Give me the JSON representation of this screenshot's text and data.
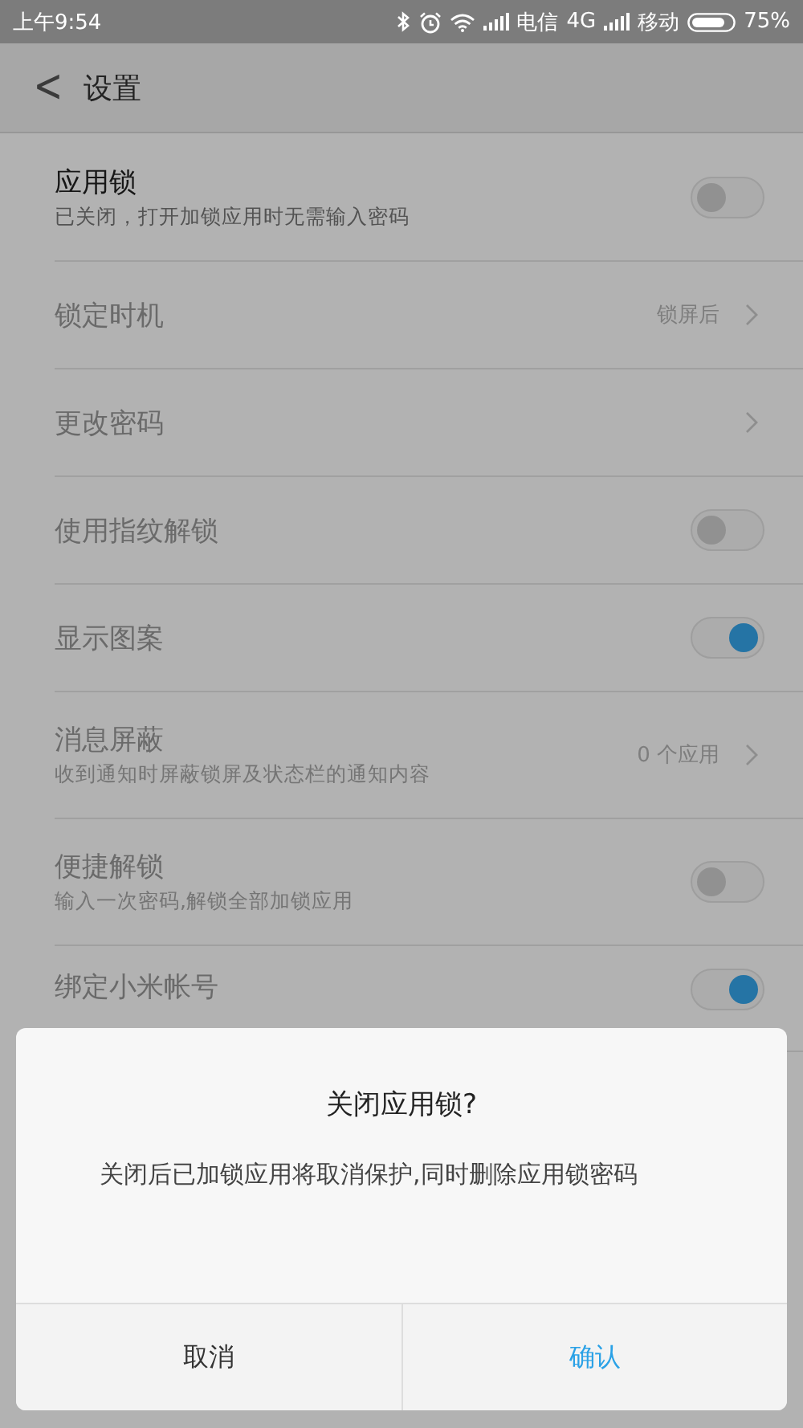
{
  "status_bar": {
    "time": "上午9:54",
    "carrier_1": "电信",
    "network": "4G",
    "carrier_2": "移动",
    "battery": "75%"
  },
  "header": {
    "back": "<",
    "title": "设置"
  },
  "settings": [
    {
      "title": "应用锁",
      "subtitle": "已关闭，打开加锁应用时无需输入密码",
      "kind": "toggle",
      "on": false,
      "disabled": false
    },
    {
      "title": "锁定时机",
      "value": "锁屏后",
      "kind": "link",
      "disabled": true
    },
    {
      "title": "更改密码",
      "kind": "link",
      "disabled": true
    },
    {
      "title": "使用指纹解锁",
      "kind": "toggle",
      "on": false,
      "disabled": true
    },
    {
      "title": "显示图案",
      "kind": "toggle",
      "on": true,
      "disabled": true
    },
    {
      "title": "消息屏蔽",
      "subtitle": "收到通知时屏蔽锁屏及状态栏的通知内容",
      "value": "0 个应用",
      "kind": "link",
      "disabled": true
    },
    {
      "title": "便捷解锁",
      "subtitle": "输入一次密码,解锁全部加锁应用",
      "kind": "toggle",
      "on": false,
      "disabled": true
    },
    {
      "title": "绑定小米帐号",
      "kind": "toggle",
      "on": true,
      "disabled": true
    }
  ],
  "dialog": {
    "title": "关闭应用锁?",
    "message": "关闭后已加锁应用将取消保护,同时删除应用锁密码",
    "buttons": [
      {
        "label": "取消",
        "kind": "cancel"
      },
      {
        "label": "确认",
        "kind": "confirm"
      }
    ]
  }
}
